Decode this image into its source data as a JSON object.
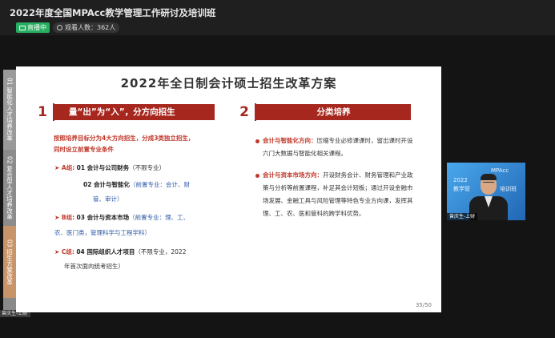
{
  "header": {
    "title": "2022年度全国MPAcc教学管理工作研讨及培训班",
    "live_label": "直播中",
    "viewers_label": "观看人数：362人"
  },
  "sidebar": {
    "items": [
      {
        "label": "01 智能化人才培养改革"
      },
      {
        "label": "02 复合型人才培养改革"
      },
      {
        "label": "03 招生方案改革"
      }
    ],
    "bottom_label": "曾庆生-上财"
  },
  "slide": {
    "title": "2022年全日制会计硕士招生改革方案",
    "section1": {
      "number": "1",
      "heading": "量“出”为“入”，分方向招生",
      "intro": "按照培养目标分为4大方向招生，分成3类独立招生，\n同时设立前置专业条件",
      "groups": {
        "a_label": "A组:",
        "a_item1": "01 会计与公司财务",
        "a_item1_note": "（不限专业）",
        "a_item2": "02 会计与智能化",
        "a_item2_note": "（前置专业：会计、财",
        "a_item2_cont": "管、审计）",
        "b_label": "B组:",
        "b_item": "03 会计与资本市场",
        "b_item_note": "（前置专业：理、工、",
        "b_item_cont": "农、医门类，管理科学与工程学科）",
        "c_label": "C组:",
        "c_item": "04 国际组织人才项目",
        "c_item_note": "（不限专业，2022",
        "c_item_cont": "年首次面向统考招生）"
      }
    },
    "section2": {
      "number": "2",
      "heading": "分类培养",
      "point1_head": "会计与智能化方向：",
      "point1_body": "压缩专业必修课课时，留出课时开设六门大数据与智能化相关课程。",
      "point2_head": "会计与资本市场方向：",
      "point2_body": "开设财务会计、财务管理和产业政策与分析等前置课程，补足其会计短板；通过开设金融市场发展、金融工具与风险管理等特色专业方向课，发挥其理、工、农、医和管科的跨学科优势。"
    },
    "page_number": "35/50"
  },
  "camera": {
    "bg_text_1": "MPAcc",
    "bg_text_2": "2022",
    "bg_text_3": "教学管",
    "bg_text_4": "培训班",
    "name_label": "曾庆生-上财"
  },
  "colors": {
    "accent_red": "#a6271e",
    "live_green": "#27ae60",
    "note_blue": "#2d5aa6"
  }
}
